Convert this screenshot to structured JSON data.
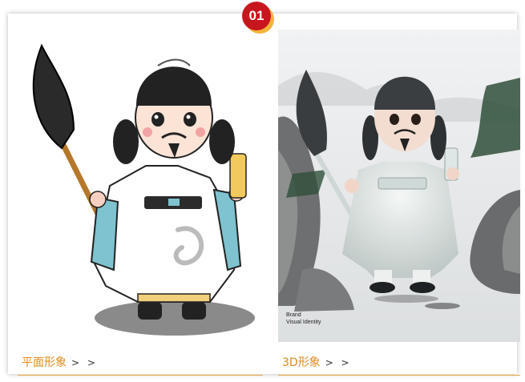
{
  "badge": {
    "number": "01"
  },
  "panels": [
    {
      "caption": "平面形象",
      "arrows": "> >",
      "image_alt": "cartoon scholar with calligraphy brush, flat style"
    },
    {
      "caption": "3D形象",
      "arrows": "> >",
      "image_alt": "3D rendered scholar with calligraphy brush among ink rocks",
      "brand_line1": "Brand",
      "brand_line2": "Visual Identity"
    }
  ],
  "colors": {
    "badge": "#c8161e",
    "caption": "#e08a1e",
    "rule": "#e6a84a"
  }
}
